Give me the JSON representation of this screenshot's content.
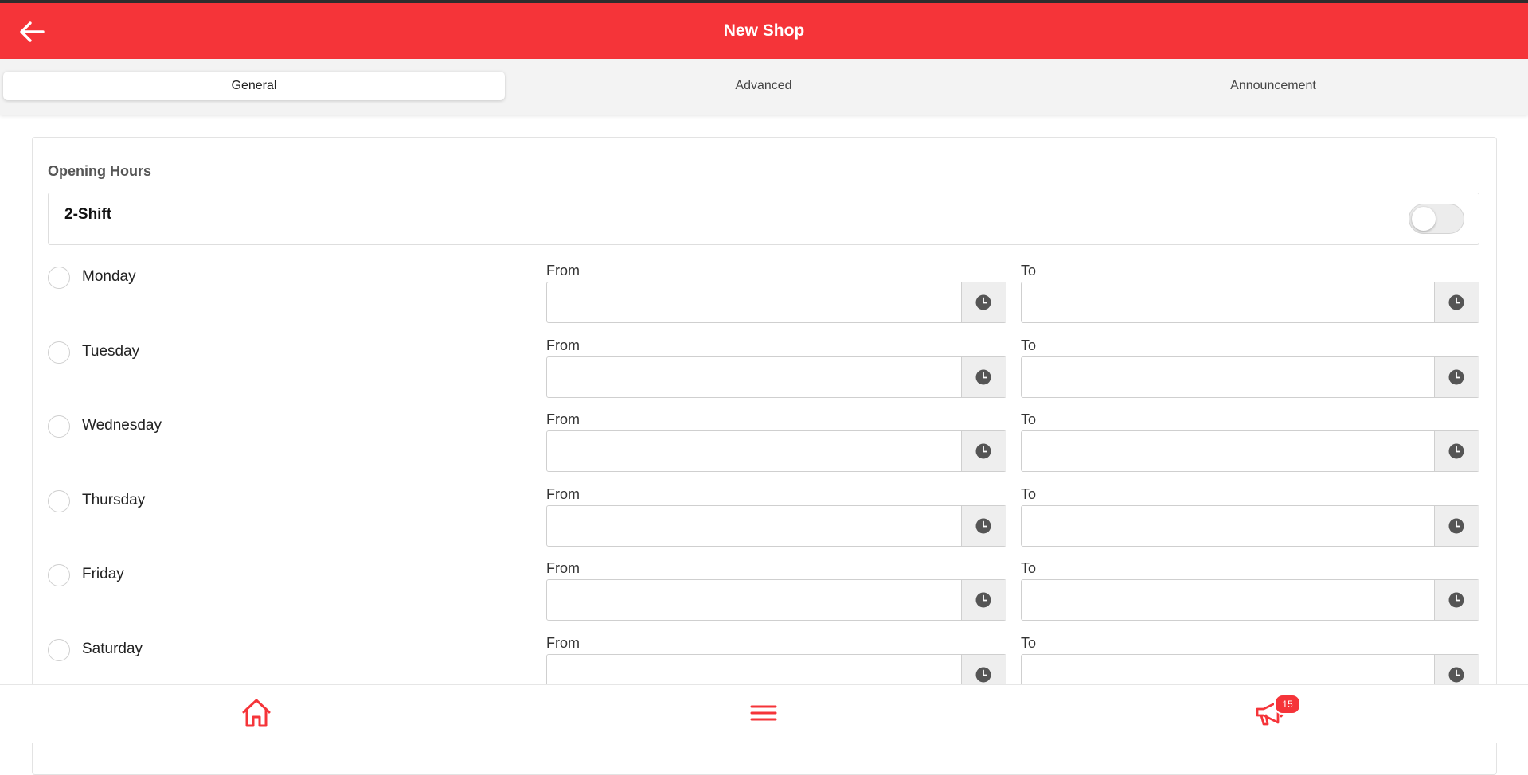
{
  "appbar": {
    "title": "New Shop",
    "back_icon": "arrow-left-icon"
  },
  "tabs": [
    {
      "label": "General",
      "active": true
    },
    {
      "label": "Advanced",
      "active": false
    },
    {
      "label": "Announcement",
      "active": false
    }
  ],
  "opening_hours": {
    "title": "Opening Hours",
    "two_shift": {
      "label": "2-Shift",
      "enabled": false
    },
    "from_label": "From",
    "to_label": "To",
    "days": [
      {
        "label": "Monday",
        "from": "",
        "to": ""
      },
      {
        "label": "Tuesday",
        "from": "",
        "to": ""
      },
      {
        "label": "Wednesday",
        "from": "",
        "to": ""
      },
      {
        "label": "Thursday",
        "from": "",
        "to": ""
      },
      {
        "label": "Friday",
        "from": "",
        "to": ""
      },
      {
        "label": "Saturday",
        "from": "",
        "to": ""
      }
    ]
  },
  "bottom_nav": {
    "items": [
      {
        "icon": "home-icon"
      },
      {
        "icon": "menu-icon"
      },
      {
        "icon": "megaphone-icon",
        "badge": "15"
      }
    ]
  },
  "colors": {
    "accent": "#f53439",
    "tab_bar": "#f3f3f3",
    "clock_icon": "#555555"
  }
}
